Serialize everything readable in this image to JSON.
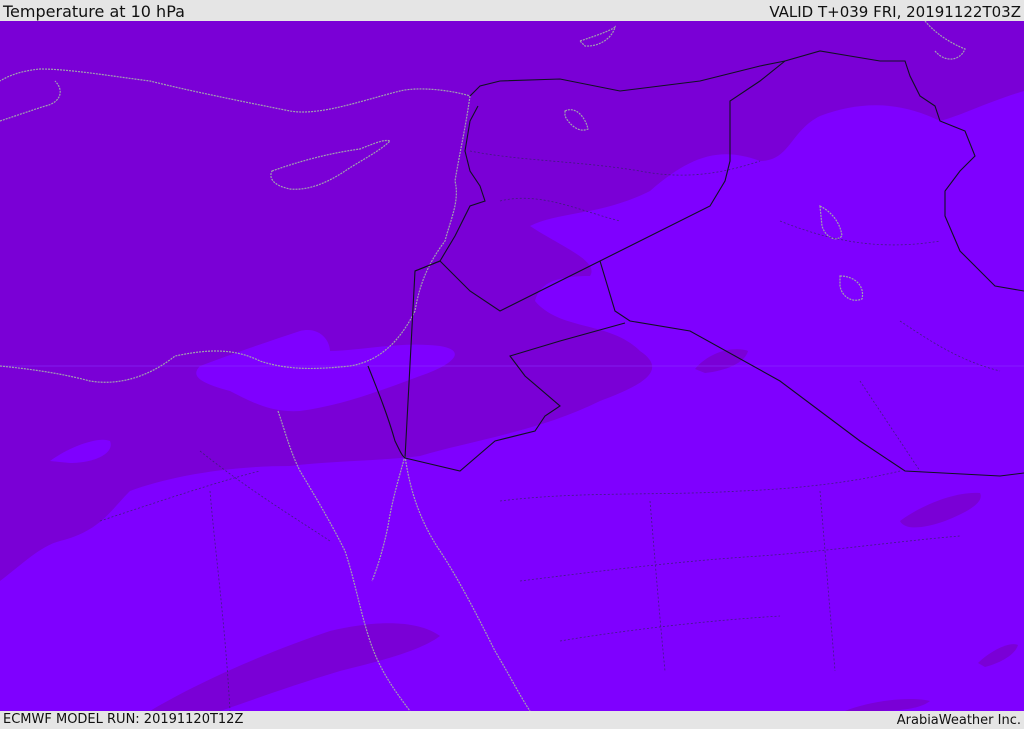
{
  "header": {
    "title": "Temperature at 10 hPa",
    "valid": "VALID T+039 FRI, 20191122T03Z"
  },
  "footer": {
    "model_run": "ECMWF MODEL RUN: 20191120T12Z",
    "credit": "ArabiaWeather Inc."
  },
  "colors": {
    "warm_band": "#7a00d6",
    "cool_band": "#7f00ff",
    "patch_dark": "#7700cc",
    "patch_light": "#8010ff",
    "coast": "#a0a0b0",
    "border": "#111122"
  }
}
